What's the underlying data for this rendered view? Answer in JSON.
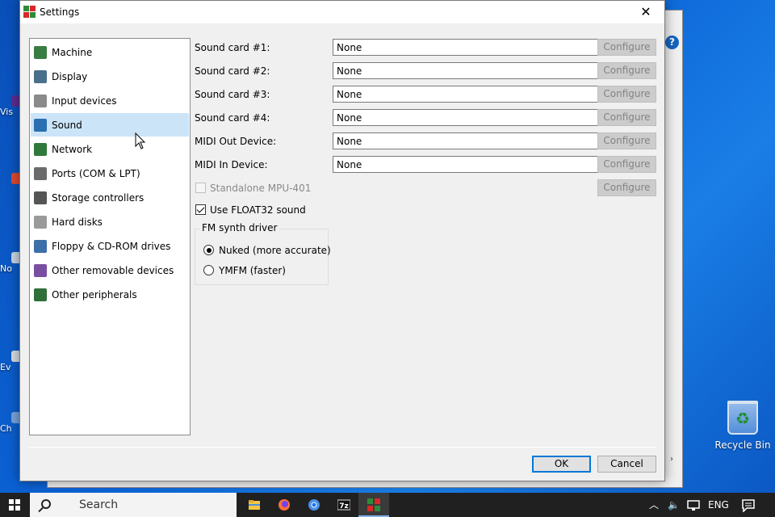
{
  "window": {
    "title": "Settings",
    "close_glyph": "✕"
  },
  "nav": {
    "items": [
      {
        "label": "Machine",
        "icon": "machine-icon"
      },
      {
        "label": "Display",
        "icon": "display-icon"
      },
      {
        "label": "Input devices",
        "icon": "input-devices-icon"
      },
      {
        "label": "Sound",
        "icon": "sound-icon",
        "selected": true
      },
      {
        "label": "Network",
        "icon": "network-icon"
      },
      {
        "label": "Ports (COM & LPT)",
        "icon": "ports-icon"
      },
      {
        "label": "Storage controllers",
        "icon": "storage-controllers-icon"
      },
      {
        "label": "Hard disks",
        "icon": "hard-disk-icon"
      },
      {
        "label": "Floppy & CD-ROM drives",
        "icon": "floppy-cdrom-icon"
      },
      {
        "label": "Other removable devices",
        "icon": "removable-device-icon"
      },
      {
        "label": "Other peripherals",
        "icon": "peripherals-icon"
      }
    ]
  },
  "sound": {
    "rows": [
      {
        "label": "Sound card #1:",
        "value": "None",
        "configure": "Configure"
      },
      {
        "label": "Sound card #2:",
        "value": "None",
        "configure": "Configure"
      },
      {
        "label": "Sound card #3:",
        "value": "None",
        "configure": "Configure"
      },
      {
        "label": "Sound card #4:",
        "value": "None",
        "configure": "Configure"
      },
      {
        "label": "MIDI Out Device:",
        "value": "None",
        "configure": "Configure"
      },
      {
        "label": "MIDI In Device:",
        "value": "None",
        "configure": "Configure"
      }
    ],
    "standalone_mpu": {
      "label": "Standalone MPU-401",
      "checked": false,
      "enabled": false,
      "configure": "Configure"
    },
    "float32": {
      "label": "Use FLOAT32 sound",
      "checked": true
    },
    "fm_synth": {
      "title": "FM synth driver",
      "options": [
        {
          "label": "Nuked (more accurate)",
          "selected": true
        },
        {
          "label": "YMFM (faster)",
          "selected": false
        }
      ]
    }
  },
  "buttons": {
    "ok": "OK",
    "cancel": "Cancel"
  },
  "desktop": {
    "recycle_bin": "Recycle Bin",
    "edge_labels": [
      "Vis",
      "No",
      "Ev",
      "Ch"
    ]
  },
  "taskbar": {
    "search_placeholder": "Search",
    "apps": [
      "file-explorer-icon",
      "firefox-icon",
      "chrome-icon",
      "7zip-icon",
      "86box-icon"
    ],
    "language": "ENG",
    "sevenzip_label": "7z"
  },
  "colors": {
    "accent": "#0078d7",
    "selection": "#cce4f7",
    "taskbar": "#202020"
  }
}
